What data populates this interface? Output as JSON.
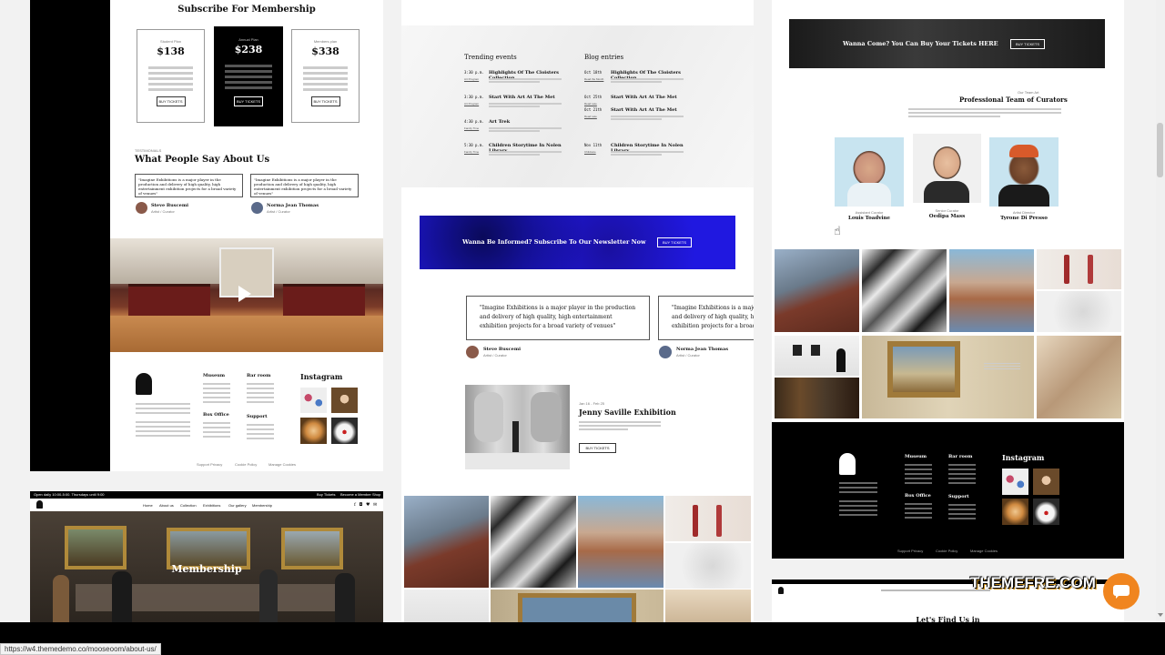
{
  "col1": {
    "subscribe_title": "Subscribe For Membership",
    "plans": [
      {
        "name": "Student Plan",
        "price": "$138",
        "button": "BUY TICKETS"
      },
      {
        "name": "Annual Plan",
        "price": "$238",
        "button": "BUY TICKETS"
      },
      {
        "name": "Members plan",
        "price": "$338",
        "button": "BUY TICKETS"
      }
    ],
    "testimonials_kicker": "TESTIMONIALS",
    "testimonials_title": "What People Say About Us",
    "quotes": [
      {
        "text": "\"Imagine Exhibitions is a major player in the production and delivery of high quality, high entertainment exhibition projects for a broad variety of venues\"",
        "name": "Steve Buscemi",
        "role": "Artist / Curator"
      },
      {
        "text": "\"Imagine Exhibitions is a major player in the production and delivery of high quality, high entertainment exhibition projects for a broad variety of venues\"",
        "name": "Norma Jean Thomas",
        "role": "Artist / Curator"
      }
    ],
    "footer": {
      "museum": "Museum",
      "bar_room": "Bar room",
      "box_office": "Box Office",
      "support": "Support",
      "instagram": "Instagram",
      "links": [
        "Support Privacy",
        "Cookie Policy",
        "Manage Cookies"
      ]
    }
  },
  "col1b": {
    "topbar_left": "Open daily 10:00-5:00. Thursdays until 9:00",
    "topbar_links": [
      "Buy Tickets",
      "Become a Member",
      "Shop"
    ],
    "nav": [
      "Home",
      "About us",
      "Collection",
      "Exhibitions",
      "Our gallery",
      "Membership"
    ],
    "hero_title": "Membership"
  },
  "col2": {
    "trending_title": "Trending events",
    "blog_title": "Blog entries",
    "events": [
      {
        "time": "3:30 p.m.",
        "tag": "Art Program",
        "title": "Highlights Of The Cloisters Collection"
      },
      {
        "time": "3:30 p.m.",
        "tag": "Art Program",
        "title": "Start With Art At The Met"
      },
      {
        "time": "4:30 p.m.",
        "tag": "Family Time",
        "title": "Art Trek"
      },
      {
        "time": "5:30 p.m.",
        "tag": "Family Time",
        "title": "Children Storytime In Nolen Library"
      }
    ],
    "blog": [
      {
        "date": "Oct 18th",
        "tag": "Read the Month",
        "title": "Highlights Of The Cloisters Collection"
      },
      {
        "date": "Oct 25th",
        "tag": "Read Late",
        "title": "Start With Art At The Met"
      },
      {
        "date": "Oct 21th",
        "tag": "Read Late",
        "title": "Start With Art At The Met"
      },
      {
        "date": "Nov 11th",
        "tag": "Childcare",
        "title": "Children Storytime In Nolen Library"
      }
    ],
    "newsletter_text": "Wanna Be Informed? Subscribe To Our Newsletter Now",
    "newsletter_button": "BUY TICKETS",
    "quotes": [
      {
        "text": "\"Imagine Exhibitions is a major player in the production and delivery of high quality, high entertainment exhibition projects for a broad variety of venues\"",
        "name": "Steve Buscemi",
        "role": "Artist / Curator"
      },
      {
        "text": "\"Imagine Exhibitions is a major player in the production and delivery of high quality, high entertainment exhibition projects for a broad variety of venues\"",
        "name": "Norma Jean Thomas",
        "role": "Artist / Curator"
      }
    ],
    "exhibition_dates": "Jan 16 - Feb 25",
    "exhibition_title": "Jenny Saville Exhibition",
    "exhibition_button": "BUY TICKETS"
  },
  "col3": {
    "ticket_banner": "Wanna Come? You Can Buy Your Tickets HERE",
    "ticket_button": "BUY TICKETS",
    "team_kicker": "Our Team Art",
    "team_title": "Professional Team of Curators",
    "team": [
      {
        "role": "Assistant Curator",
        "name": "Louis Toadvine"
      },
      {
        "role": "Senior Curator",
        "name": "Oedipa Mass"
      },
      {
        "role": "Artist Director",
        "name": "Tyrone Di Presso"
      }
    ],
    "footer": {
      "museum": "Museum",
      "bar_room": "Bar room",
      "box_office": "Box Office",
      "support": "Support",
      "instagram": "Instagram",
      "links": [
        "Support Privacy",
        "Cookie Policy",
        "Manage Cookies"
      ]
    },
    "find_us": "Let's Find Us in",
    "watermark": "THEMEFRE.COM"
  },
  "status_url": "https://w4.themedemo.co/mooseoom/about-us/",
  "colors": {
    "accent_blue": "#2018e0",
    "chat_orange": "#f0851f"
  }
}
